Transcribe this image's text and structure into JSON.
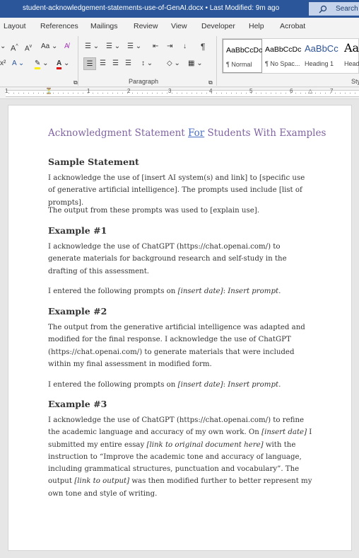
{
  "titlebar": {
    "document_title": "student-acknowledgement-statements-use-of-GenAI.docx",
    "modified": "Last Modified: 9m ago",
    "search_label": "Search"
  },
  "tabs": [
    "Layout",
    "References",
    "Mailings",
    "Review",
    "View",
    "Developer",
    "Help",
    "Acrobat"
  ],
  "ribbon": {
    "font_grow": "A",
    "font_shrink": "A",
    "change_case": "Aa",
    "superscript": "x²",
    "paragraph_group": "Paragraph",
    "styles_group": "Sty",
    "styles": [
      {
        "sample": "AaBbCcDc",
        "name": "¶ Normal"
      },
      {
        "sample": "AaBbCcDc",
        "name": "¶ No Spac..."
      },
      {
        "sample": "AaBbCc",
        "name": "Heading 1"
      },
      {
        "sample": "Aa",
        "name": "Head"
      }
    ]
  },
  "ruler": {
    "numbers": [
      "1",
      "1",
      "2",
      "3",
      "4",
      "5",
      "6",
      "7"
    ]
  },
  "document": {
    "title_before": "Acknowledgment Statement ",
    "title_underlined": "For",
    "title_after": " Students With Examples",
    "sections": [
      {
        "heading": "Sample Statement",
        "paragraphs": [
          "I acknowledge the use of [insert AI system(s) and link] to [specific use of generative artificial intelligence]. The prompts used include [list of prompts].",
          "The output from these prompts was used to [explain use]."
        ]
      },
      {
        "heading": "Example #1",
        "paragraphs": [
          "I acknowledge the use of ChatGPT (https://chat.openai.com/) to generate materials for background research and self-study in the drafting of this assessment."
        ],
        "prompt_line": {
          "lead": "I entered the following prompts on ",
          "date": "[insert date]",
          "sep": ": ",
          "prompt": "Insert prompt."
        }
      },
      {
        "heading": "Example #2",
        "paragraphs": [
          "The output from the generative artificial intelligence was adapted and modified for the final response. I acknowledge the use of ChatGPT (https://chat.openai.com/) to generate materials that were included within my final assessment in modified form."
        ],
        "prompt_line": {
          "lead": "I entered the following prompts on ",
          "date": "[insert date]",
          "sep": ": ",
          "prompt": "Insert prompt."
        }
      },
      {
        "heading": "Example #3",
        "p1": "I acknowledge the use of ChatGPT (https://chat.openai.com/) to refine the academic language and accuracy of my own work. On ",
        "p1_date": "[insert date]",
        "p2": " I submitted my entire essay ",
        "p2_link": "[link to original document here]",
        "p3": " with the instruction to “Improve the academic tone and accuracy of language, including grammatical structures, punctuation and vocabulary”. The output ",
        "p3_link": "[link to output]",
        "p4": " was then modified further to better represent my own tone and style of writing."
      }
    ]
  }
}
